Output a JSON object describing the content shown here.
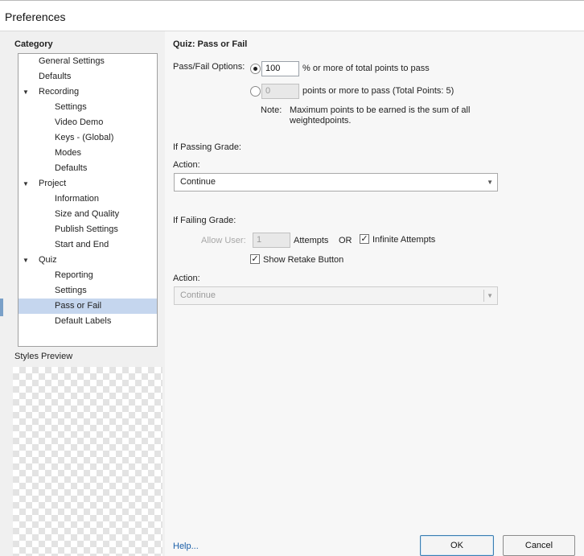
{
  "window": {
    "title": "Preferences"
  },
  "sidebar": {
    "category_label": "Category",
    "items": [
      {
        "label": "General Settings",
        "level": 0,
        "expandable": false,
        "selected": false
      },
      {
        "label": "Defaults",
        "level": 0,
        "expandable": false,
        "selected": false
      },
      {
        "label": "Recording",
        "level": 0,
        "expandable": true,
        "selected": false
      },
      {
        "label": "Settings",
        "level": 1,
        "expandable": false,
        "selected": false
      },
      {
        "label": "Video Demo",
        "level": 1,
        "expandable": false,
        "selected": false
      },
      {
        "label": "Keys - (Global)",
        "level": 1,
        "expandable": false,
        "selected": false
      },
      {
        "label": "Modes",
        "level": 1,
        "expandable": false,
        "selected": false
      },
      {
        "label": "Defaults",
        "level": 1,
        "expandable": false,
        "selected": false
      },
      {
        "label": "Project",
        "level": 0,
        "expandable": true,
        "selected": false
      },
      {
        "label": "Information",
        "level": 1,
        "expandable": false,
        "selected": false
      },
      {
        "label": "Size and Quality",
        "level": 1,
        "expandable": false,
        "selected": false
      },
      {
        "label": "Publish Settings",
        "level": 1,
        "expandable": false,
        "selected": false
      },
      {
        "label": "Start and End",
        "level": 1,
        "expandable": false,
        "selected": false
      },
      {
        "label": "Quiz",
        "level": 0,
        "expandable": true,
        "selected": false
      },
      {
        "label": "Reporting",
        "level": 1,
        "expandable": false,
        "selected": false
      },
      {
        "label": "Settings",
        "level": 1,
        "expandable": false,
        "selected": false
      },
      {
        "label": "Pass or Fail",
        "level": 1,
        "expandable": false,
        "selected": true
      },
      {
        "label": "Default Labels",
        "level": 1,
        "expandable": false,
        "selected": false
      }
    ],
    "expand_glyph": "▼",
    "styles_preview_label": "Styles Preview"
  },
  "main": {
    "heading": "Quiz: Pass or Fail",
    "pass_fail_options_label": "Pass/Fail Options:",
    "option_percent": {
      "value": "100",
      "suffix": "% or more of total points to pass",
      "selected": true
    },
    "option_points": {
      "value": "0",
      "suffix": "points or more to pass (Total Points: 5)",
      "selected": false
    },
    "note_label": "Note:",
    "note_line1": "Maximum points to be earned is the sum of all",
    "note_line2": "weightedpoints.",
    "if_passing_label": "If Passing Grade:",
    "passing_action_label": "Action:",
    "passing_action_value": "Continue",
    "if_failing_label": "If Failing Grade:",
    "allow_user_label": "Allow User:",
    "attempts_value": "1",
    "attempts_label": "Attempts",
    "or_label": "OR",
    "infinite_attempts_label": "Infinite Attempts",
    "infinite_attempts_checked": true,
    "show_retake_label": "Show Retake Button",
    "show_retake_checked": true,
    "failing_action_label": "Action:",
    "failing_action_value": "Continue",
    "check_glyph": "✓",
    "caret_glyph": "▼",
    "help_link": "Help..."
  },
  "footer": {
    "ok_label": "OK",
    "cancel_label": "Cancel"
  }
}
